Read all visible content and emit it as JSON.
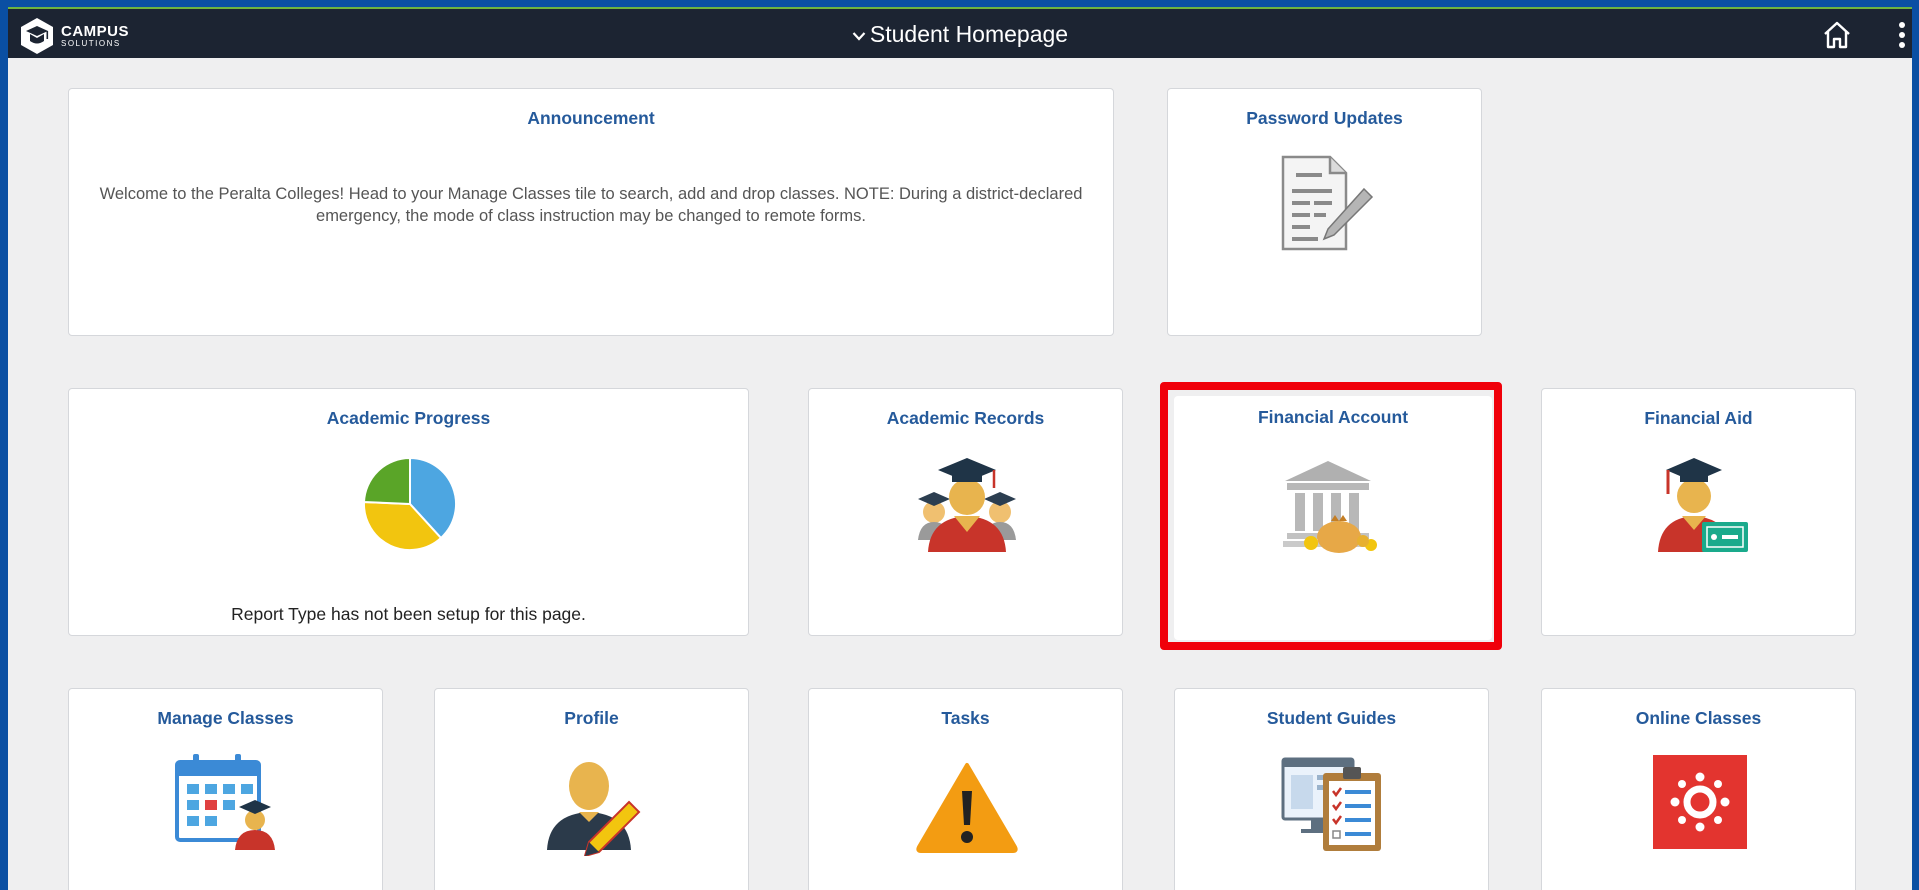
{
  "header": {
    "logo_line1": "CAMPUS",
    "logo_line2": "SOLUTIONS",
    "title": "Student Homepage"
  },
  "tiles": {
    "announcement": {
      "title": "Announcement",
      "text": "Welcome to the Peralta Colleges! Head to your Manage Classes tile to search, add and drop classes. NOTE: During a district-declared emergency, the mode of class instruction may be changed to remote forms."
    },
    "password_updates": {
      "title": "Password Updates",
      "icon": "document-pencil-icon"
    },
    "academic_progress": {
      "title": "Academic Progress",
      "icon": "pie-chart-icon",
      "message": "Report Type has not been setup for this page."
    },
    "academic_records": {
      "title": "Academic Records",
      "icon": "graduates-icon"
    },
    "financial_account": {
      "title": "Financial Account",
      "icon": "bank-money-icon",
      "highlighted": true,
      "highlight_color": "#f0000a"
    },
    "financial_aid": {
      "title": "Financial Aid",
      "icon": "graduate-cash-icon"
    },
    "manage_classes": {
      "title": "Manage Classes",
      "icon": "calendar-graduate-icon"
    },
    "profile": {
      "title": "Profile",
      "icon": "person-pencil-icon"
    },
    "tasks": {
      "title": "Tasks",
      "icon": "warning-icon"
    },
    "student_guides": {
      "title": "Student Guides",
      "icon": "monitor-checklist-icon"
    },
    "online_classes": {
      "title": "Online Classes",
      "icon": "canvas-logo-icon"
    }
  },
  "colors": {
    "header_bg": "#1c2432",
    "tile_title": "#255a9b",
    "page_bg": "#efeff0",
    "outer_border": "#0a4fa3"
  }
}
